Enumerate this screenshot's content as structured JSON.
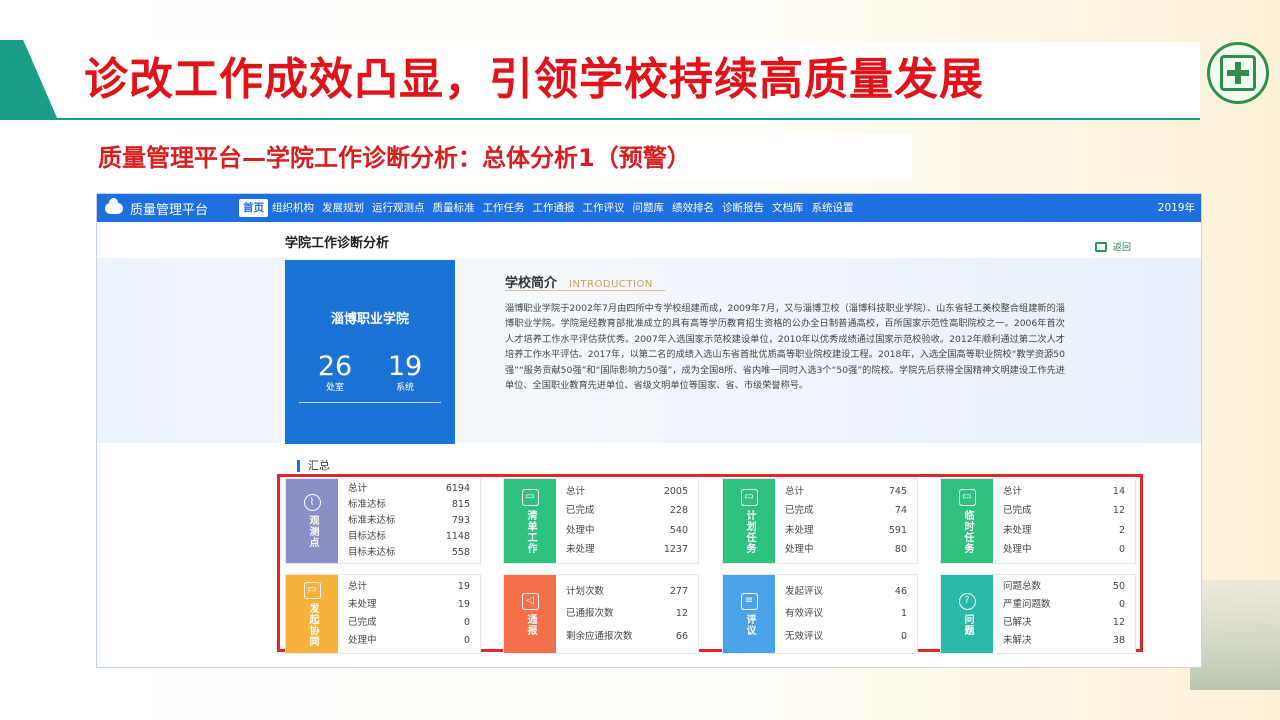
{
  "slide": {
    "title": "诊改工作成效凸显，引领学校持续高质量发展",
    "subtitle": "质量管理平台—学院工作诊断分析：总体分析1（预警）"
  },
  "app": {
    "brand": "质量管理平台",
    "nav": [
      "首页",
      "组织机构",
      "发展规划",
      "运行观测点",
      "质量标准",
      "工作任务",
      "工作通报",
      "工作评议",
      "问题库",
      "绩效排名",
      "诊断报告",
      "文档库",
      "系统设置"
    ],
    "year": "2019年",
    "page_title": "学院工作诊断分析",
    "back": "返回",
    "school": {
      "name": "淄博职业学院",
      "departments": "26",
      "departments_label": "处室",
      "systems": "19",
      "systems_label": "系统"
    },
    "intro": {
      "title": "学校简介",
      "en": "INTRODUCTION",
      "text": "淄博职业学院于2002年7月由四所中专学校组建而成，2009年7月，又与淄博卫校（淄博科技职业学院）、山东省轻工美校整合组建新的淄博职业学院。学院是经教育部批准成立的具有高等学历教育招生资格的公办全日制普通高校，百所国家示范性高职院校之一。2006年首次人才培养工作水平评估获优秀。2007年入选国家示范校建设单位，2010年以优秀成绩通过国家示范校验收。2012年顺利通过第二次人才培养工作水平评估。2017年，以第二名的成绩入选山东省首批优质高等职业院校建设工程。2018年，入选全国高等职业院校“教学资源50强”“服务贡献50强”和“国际影响力50强”，成为全国8所、省内唯一同时入选3个“50强”的院校。学院先后获得全国精神文明建设工作先进单位、全国职业教育先进单位、省级文明单位等国家、省、市级荣誉称号。"
    },
    "summary_label": "汇总",
    "cards": [
      {
        "label": "观测点",
        "icon": "chart-icon",
        "glyph": "⌇",
        "color": "#8a8fc6",
        "rows": [
          [
            "总计",
            "6194"
          ],
          [
            "标准达标",
            "815"
          ],
          [
            "标准未达标",
            "793"
          ],
          [
            "目标达标",
            "1148"
          ],
          [
            "目标未达标",
            "558"
          ]
        ]
      },
      {
        "label": "清单工作",
        "icon": "briefcase-icon",
        "glyph": "▭",
        "color": "#2ec27e",
        "rows": [
          [
            "总计",
            "2005"
          ],
          [
            "已完成",
            "228"
          ],
          [
            "处理中",
            "540"
          ],
          [
            "未处理",
            "1237"
          ]
        ]
      },
      {
        "label": "计划任务",
        "icon": "briefcase-icon",
        "glyph": "▭",
        "color": "#2ec27e",
        "rows": [
          [
            "总计",
            "745"
          ],
          [
            "已完成",
            "74"
          ],
          [
            "未处理",
            "591"
          ],
          [
            "处理中",
            "80"
          ]
        ]
      },
      {
        "label": "临时任务",
        "icon": "briefcase-icon",
        "glyph": "▭",
        "color": "#2ec27e",
        "rows": [
          [
            "总计",
            "14"
          ],
          [
            "已完成",
            "12"
          ],
          [
            "未处理",
            "2"
          ],
          [
            "处理中",
            "0"
          ]
        ]
      },
      {
        "label": "发起协同",
        "icon": "briefcase-icon",
        "glyph": "▭",
        "color": "#f6b23c",
        "rows": [
          [
            "总计",
            "19"
          ],
          [
            "未处理",
            "19"
          ],
          [
            "已完成",
            "0"
          ],
          [
            "处理中",
            "0"
          ]
        ]
      },
      {
        "label": "通报",
        "icon": "speaker-icon",
        "glyph": "◁",
        "color": "#f5704a",
        "rows": [
          [
            "计划次数",
            "277"
          ],
          [
            "已通报次数",
            "12"
          ],
          [
            "剩余应通报次数",
            "66"
          ]
        ]
      },
      {
        "label": "评议",
        "icon": "comment-icon",
        "glyph": "≡",
        "color": "#4aa3e8",
        "rows": [
          [
            "发起评议",
            "46"
          ],
          [
            "有效评议",
            "1"
          ],
          [
            "无效评议",
            "0"
          ]
        ]
      },
      {
        "label": "问题",
        "icon": "question-icon",
        "glyph": "?",
        "color": "#2bb8a8",
        "rows": [
          [
            "问题总数",
            "50"
          ],
          [
            "严重问题数",
            "0"
          ],
          [
            "已解决",
            "12"
          ],
          [
            "未解决",
            "38"
          ]
        ]
      }
    ]
  }
}
